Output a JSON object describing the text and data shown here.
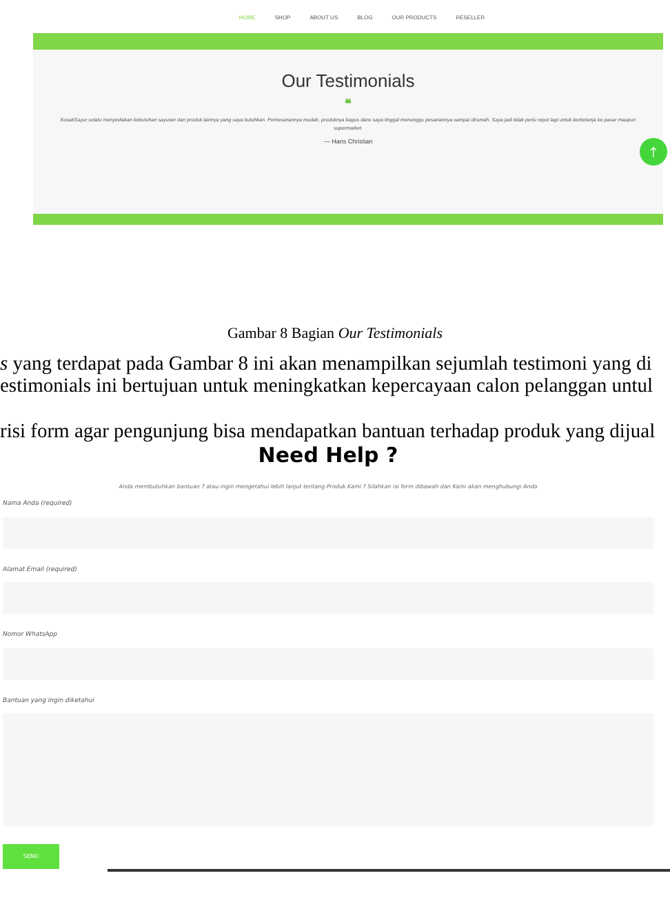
{
  "figure_1": {
    "nav": [
      {
        "label": "HOME",
        "selected": true
      },
      {
        "label": "SHOP",
        "selected": false
      },
      {
        "label": "ABOUT US",
        "selected": false
      },
      {
        "label": "BLOG",
        "selected": false
      },
      {
        "label": "OUR PRODUCTS",
        "selected": false
      },
      {
        "label": "RESELLER",
        "selected": false
      }
    ],
    "title": "Our Testimonials",
    "quote_mark": "❝",
    "quote": "KosakSayur selalu menyediakan kebutuhan sayuran dan produk lainnya yang saya butuhkan. Pemesanannya mudah, produknya bagus dans saya tinggal menunggu pesanannya sampai dirumah. Saya jadi tidak perlu repot lagi untuk berbelanja ke pasar maupun supermarket.",
    "author": "— Hans Christian"
  },
  "caption_1": "Gambar 8 Bagian *Our Testimonials*",
  "body_lines": [
    "*s* yang terdapat pada Gambar 8 ini akan menampilkan sejumlah testimoni yang di",
    "estimonials ini bertujuan untuk meningkatkan kepercayaan calon pelanggan untul",
    "risi form agar pengunjung bisa mendapatkan bantuan terhadap produk yang dijual"
  ],
  "figure_2": {
    "title": "Need Help ?",
    "intro": "Anda membutuhkan bantuan ? atau ingin mengetahui lebih lanjut tentang Produk Kami ? Silahkan isi form dibawah dan Kami akan menghubungi Anda",
    "fields": [
      {
        "label": "Nama Anda (required)",
        "kind": "input"
      },
      {
        "label": "Alamat Email (required)",
        "kind": "input"
      },
      {
        "label": "Nomor WhatsApp",
        "kind": "input"
      },
      {
        "label": "Bantuan yang ingin diketahui",
        "kind": "textarea"
      }
    ],
    "button": "SEND"
  }
}
